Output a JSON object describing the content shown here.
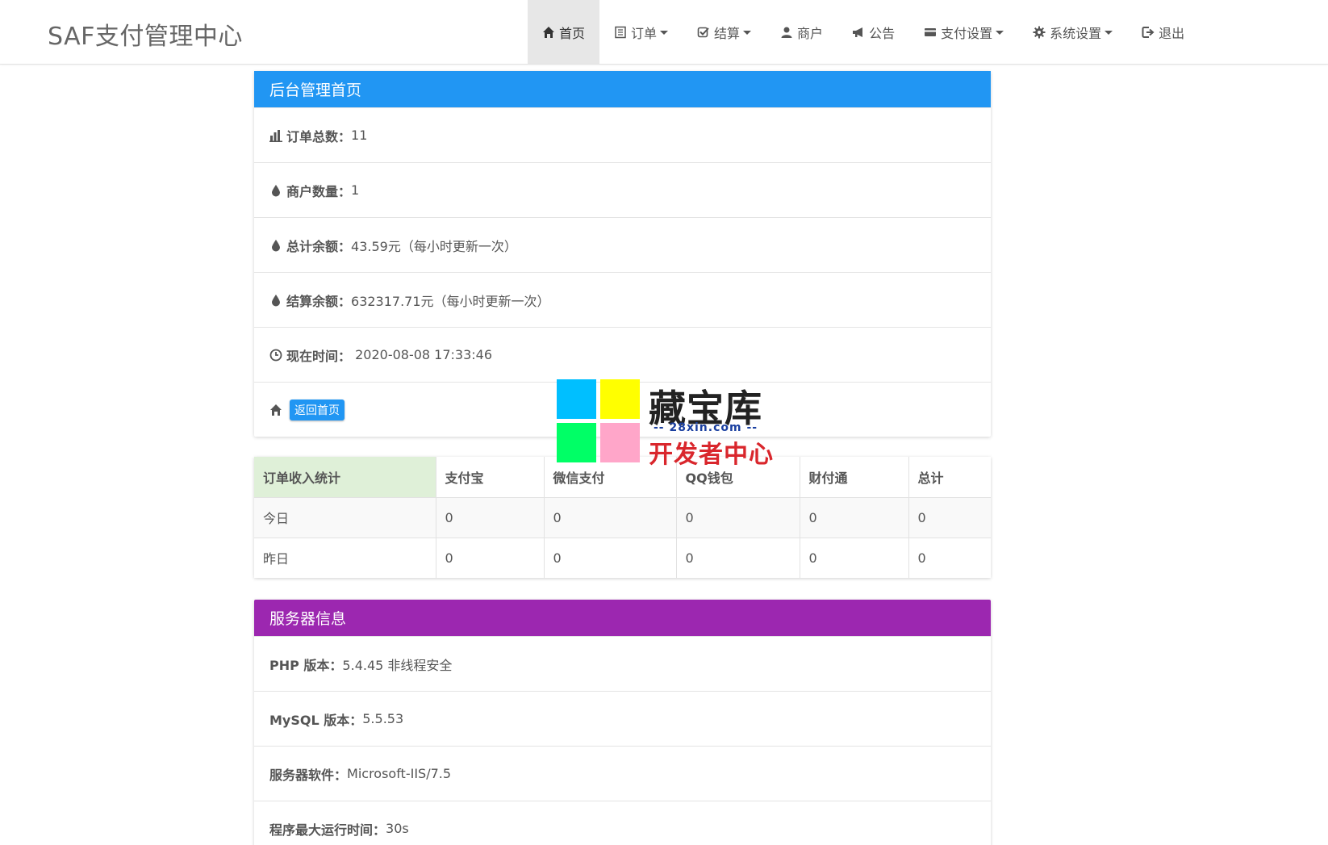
{
  "app": {
    "title": "SAF支付管理中心"
  },
  "nav": [
    {
      "label": "首页",
      "icon": "home-icon",
      "dropdown": false,
      "active": true
    },
    {
      "label": "订单",
      "icon": "list-icon",
      "dropdown": true,
      "active": false
    },
    {
      "label": "结算",
      "icon": "check-square-icon",
      "dropdown": true,
      "active": false
    },
    {
      "label": "商户",
      "icon": "user-icon",
      "dropdown": false,
      "active": false
    },
    {
      "label": "公告",
      "icon": "bullhorn-icon",
      "dropdown": false,
      "active": false
    },
    {
      "label": "支付设置",
      "icon": "credit-card-icon",
      "dropdown": true,
      "active": false
    },
    {
      "label": "系统设置",
      "icon": "gear-icon",
      "dropdown": true,
      "active": false
    },
    {
      "label": "退出",
      "icon": "logout-icon",
      "dropdown": false,
      "active": false
    }
  ],
  "dashboard": {
    "title": "后台管理首页",
    "order_total_label": "订单总数：",
    "order_total_value": "11",
    "merchant_count_label": "商户数量：",
    "merchant_count_value": "1",
    "total_balance_label": "总计余额：",
    "total_balance_value": "43.59元（每小时更新一次）",
    "settle_balance_label": "结算余额：",
    "settle_balance_value": "632317.71元（每小时更新一次）",
    "now_time_label": "现在时间：",
    "now_time_value": " 2020-08-08 17:33:46",
    "home_button": "返回首页"
  },
  "stats_table": {
    "headers": [
      "订单收入统计",
      "支付宝",
      "微信支付",
      "QQ钱包",
      "财付通",
      "总计"
    ],
    "rows": [
      [
        "今日",
        "0",
        "0",
        "0",
        "0",
        "0"
      ],
      [
        "昨日",
        "0",
        "0",
        "0",
        "0",
        "0"
      ]
    ]
  },
  "server_info": {
    "title": "服务器信息",
    "php_label": "PHP 版本：",
    "php_value": "5.4.45 非线程安全",
    "mysql_label": "MySQL 版本：",
    "mysql_value": "5.5.53",
    "software_label": "服务器软件：",
    "software_value": "Microsoft-IIS/7.5",
    "max_time_label": "程序最大运行时间：",
    "max_time_value": "30s"
  },
  "watermark": {
    "title": "藏宝库",
    "url": "-- 28xin.com --",
    "subtitle": "开发者中心",
    "colors": [
      "#00bfff",
      "#ffff00",
      "#00ff66",
      "#ffa6c9"
    ]
  },
  "colors": {
    "primary": "#2196f3",
    "purple": "#9c27b0",
    "highlight": "#dff0d8"
  }
}
